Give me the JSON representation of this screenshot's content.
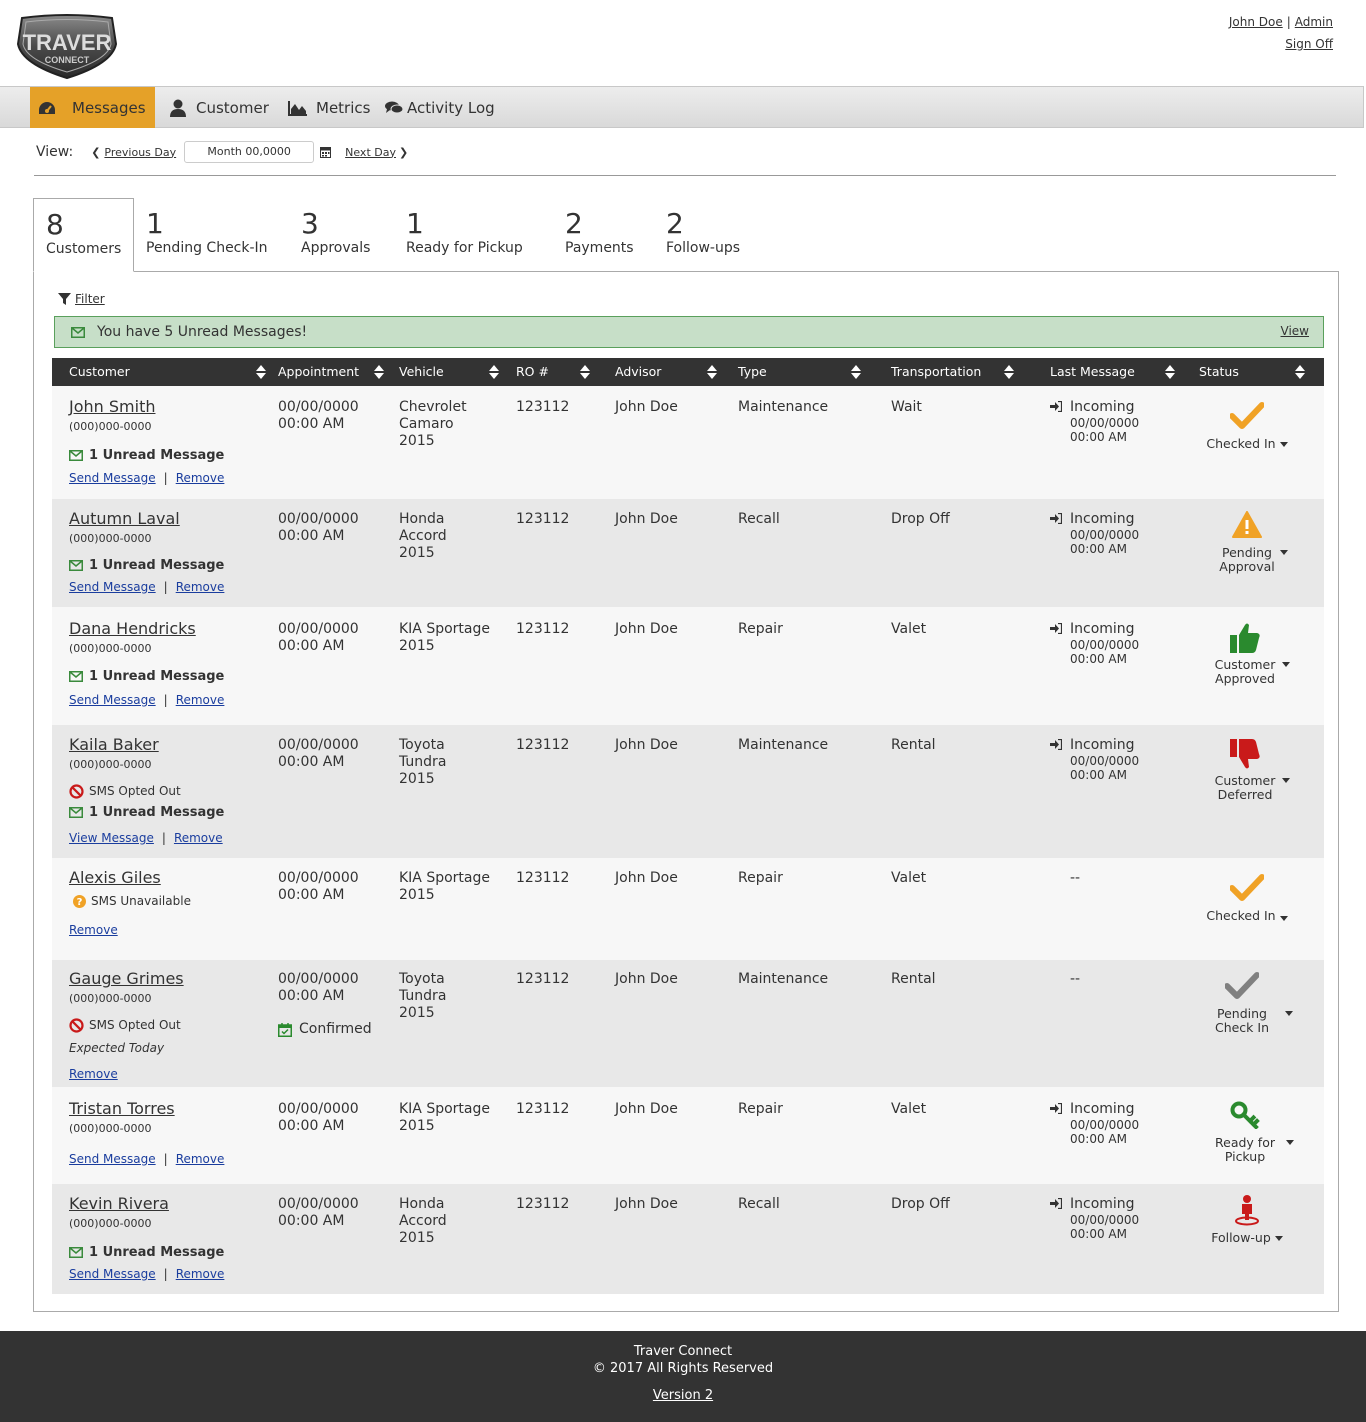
{
  "logo": {
    "line1": "TRAVER",
    "line2": "CONNECT"
  },
  "user": {
    "name": "John Doe",
    "role": "Admin",
    "signoff": "Sign Off"
  },
  "nav": {
    "messages": "Messages",
    "customer": "Customer",
    "metrics": "Metrics",
    "activity": "Activity Log"
  },
  "view": {
    "label": "View:",
    "prev": "Previous Day",
    "date": "Month 00,0000",
    "next": "Next Day"
  },
  "tabs": [
    {
      "num": "8",
      "label": "Customers"
    },
    {
      "num": "1",
      "label": "Pending Check-In"
    },
    {
      "num": "3",
      "label": "Approvals"
    },
    {
      "num": "1",
      "label": "Ready for Pickup"
    },
    {
      "num": "2",
      "label": "Payments"
    },
    {
      "num": "2",
      "label": "Follow-ups"
    }
  ],
  "filter": "Filter",
  "alert": {
    "message": "You have 5 Unread Messages!",
    "view": "View"
  },
  "columns": [
    "Customer",
    "Appointment",
    "Vehicle",
    "RO #",
    "Advisor",
    "Type",
    "Transportation",
    "Last Message",
    "Status"
  ],
  "rows": [
    {
      "name": "John Smith",
      "phone": "(000)000-0000",
      "unread": "1 Unread Message",
      "action1": "Send Message",
      "action2": "Remove",
      "date": "00/00/0000",
      "time": "00:00 AM",
      "vehicle": [
        "Chevrolet",
        "Camaro",
        "2015"
      ],
      "ro": "123112",
      "advisor": "John Doe",
      "type": "Maintenance",
      "transport": "Wait",
      "lm": "Incoming",
      "lm_date": "00/00/0000",
      "lm_time": "00:00 AM",
      "status": [
        "Checked In"
      ]
    },
    {
      "name": "Autumn Laval",
      "phone": "(000)000-0000",
      "unread": "1 Unread Message",
      "action1": "Send Message",
      "action2": "Remove",
      "date": "00/00/0000",
      "time": "00:00 AM",
      "vehicle": [
        "Honda",
        "Accord",
        "2015"
      ],
      "ro": "123112",
      "advisor": "John Doe",
      "type": "Recall",
      "transport": "Drop Off",
      "lm": "Incoming",
      "lm_date": "00/00/0000",
      "lm_time": "00:00 AM",
      "status": [
        "Pending",
        "Approval"
      ]
    },
    {
      "name": "Dana Hendricks",
      "phone": "(000)000-0000",
      "unread": "1 Unread Message",
      "action1": "Send Message",
      "action2": "Remove",
      "date": "00/00/0000",
      "time": "00:00 AM",
      "vehicle": [
        "KIA Sportage",
        "2015"
      ],
      "ro": "123112",
      "advisor": "John Doe",
      "type": "Repair",
      "transport": "Valet",
      "lm": "Incoming",
      "lm_date": "00/00/0000",
      "lm_time": "00:00 AM",
      "status": [
        "Customer",
        "Approved"
      ]
    },
    {
      "name": "Kaila Baker",
      "phone": "(000)000-0000",
      "sms": "SMS Opted Out",
      "unread": "1 Unread Message",
      "action1": "View Message",
      "action2": "Remove",
      "date": "00/00/0000",
      "time": "00:00 AM",
      "vehicle": [
        "Toyota",
        "Tundra",
        "2015"
      ],
      "ro": "123112",
      "advisor": "John Doe",
      "type": "Maintenance",
      "transport": "Rental",
      "lm": "Incoming",
      "lm_date": "00/00/0000",
      "lm_time": "00:00 AM",
      "status": [
        "Customer",
        "Deferred"
      ]
    },
    {
      "name": "Alexis Giles",
      "sms": "SMS Unavailable",
      "action2": "Remove",
      "date": "00/00/0000",
      "time": "00:00 AM",
      "vehicle": [
        "KIA Sportage",
        "2015"
      ],
      "ro": "123112",
      "advisor": "John Doe",
      "type": "Repair",
      "transport": "Valet",
      "lm": "--",
      "status": [
        "Checked In"
      ]
    },
    {
      "name": "Gauge Grimes",
      "phone": "(000)000-0000",
      "sms": "SMS Opted Out",
      "expected": "Expected Today",
      "action2": "Remove",
      "date": "00/00/0000",
      "time": "00:00 AM",
      "confirmed": "Confirmed",
      "vehicle": [
        "Toyota",
        "Tundra",
        "2015"
      ],
      "ro": "123112",
      "advisor": "John Doe",
      "type": "Maintenance",
      "transport": "Rental",
      "lm": "--",
      "status": [
        "Pending",
        "Check In"
      ]
    },
    {
      "name": "Tristan Torres",
      "phone": "(000)000-0000",
      "action1": "Send Message",
      "action2": "Remove",
      "date": "00/00/0000",
      "time": "00:00 AM",
      "vehicle": [
        "KIA Sportage",
        "2015"
      ],
      "ro": "123112",
      "advisor": "John Doe",
      "type": "Repair",
      "transport": "Valet",
      "lm": "Incoming",
      "lm_date": "00/00/0000",
      "lm_time": "00:00 AM",
      "status": [
        "Ready for",
        "Pickup"
      ]
    },
    {
      "name": "Kevin Rivera",
      "phone": "(000)000-0000",
      "unread": "1 Unread Message",
      "action1": "Send Message",
      "action2": "Remove",
      "date": "00/00/0000",
      "time": "00:00 AM",
      "vehicle": [
        "Honda",
        "Accord",
        "2015"
      ],
      "ro": "123112",
      "advisor": "John Doe",
      "type": "Recall",
      "transport": "Drop Off",
      "lm": "Incoming",
      "lm_date": "00/00/0000",
      "lm_time": "00:00 AM",
      "status": [
        "Follow-up"
      ]
    }
  ],
  "colors": {
    "accent": "#e5a128",
    "success": "#3a8a3c",
    "danger": "#c91a1a",
    "header": "#333333"
  },
  "footer": {
    "line1": "Traver Connect",
    "line2": "© 2017 All Rights Reserved",
    "version": "Version 2"
  }
}
